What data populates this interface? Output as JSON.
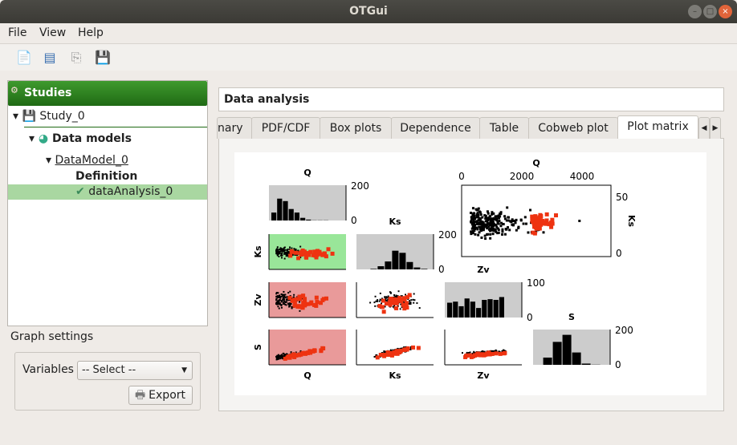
{
  "window": {
    "title": "OTGui"
  },
  "menu": [
    "File",
    "View",
    "Help"
  ],
  "toolbar": [
    {
      "icon": "new-study-icon"
    },
    {
      "icon": "open-study-icon"
    },
    {
      "icon": "import-icon"
    },
    {
      "icon": "save-icon"
    }
  ],
  "studies": {
    "header": "Studies",
    "study": "Study_0",
    "data_models": "Data models",
    "data_model": "DataModel_0",
    "definition": "Definition",
    "analysis": "dataAnalysis_0"
  },
  "graph_settings": {
    "title": "Graph settings",
    "variables_label": "Variables",
    "variables_value": "-- Select --",
    "export_label": "Export"
  },
  "panel": {
    "title": "Data analysis",
    "tabs": [
      "nary",
      "PDF/CDF",
      "Box plots",
      "Dependence",
      "Table",
      "Cobweb plot",
      "Plot matrix"
    ],
    "active_tab": "Plot matrix"
  },
  "plot_matrix": {
    "variables": [
      "Q",
      "Ks",
      "Zv",
      "S"
    ],
    "colors": {
      "points": "#000000",
      "highlight": "#ee3311",
      "hist_bg": "#cccccc",
      "green_bg": "#99e699",
      "red_bg": "#e99a9a"
    },
    "histograms": {
      "Q": {
        "counts": [
          45,
          124,
          110,
          65,
          45,
          15,
          5,
          1,
          1,
          1
        ],
        "ymax_label": "200",
        "ymin_label": "0"
      },
      "Ks": {
        "counts": [
          3,
          18,
          45,
          106,
          94,
          42,
          11,
          3
        ],
        "ymax_label": "200",
        "ymin_label": "0"
      },
      "Zv": {
        "counts": [
          42,
          45,
          32,
          54,
          45,
          27,
          50,
          52,
          50,
          58
        ],
        "ymax_label": "100",
        "ymin_label": "0"
      },
      "S": {
        "counts": [
          41,
          130,
          170,
          70,
          7,
          1
        ],
        "ymax_label": "200",
        "ymin_label": "0"
      }
    },
    "zoom_plot": {
      "xlabel": "Q",
      "ylabel": "Ks",
      "xticks": [
        "0",
        "2000",
        "4000"
      ],
      "yticks": [
        "50",
        "0"
      ]
    }
  }
}
